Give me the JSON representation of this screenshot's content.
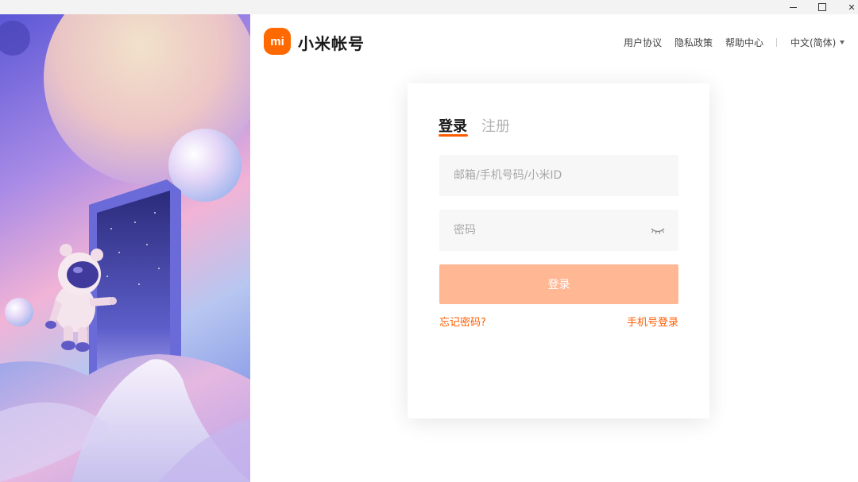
{
  "window": {
    "minimize_icon": "minimize-icon",
    "maximize_icon": "maximize-icon",
    "close_icon": "close-icon",
    "close_glyph": "✕"
  },
  "header": {
    "logo_text": "mi",
    "brand_name": "小米帐号",
    "nav": [
      "用户协议",
      "隐私政策",
      "帮助中心"
    ],
    "language": "中文(简体)"
  },
  "login": {
    "tabs": [
      {
        "label": "登录",
        "active": true
      },
      {
        "label": "注册",
        "active": false
      }
    ],
    "account_placeholder": "邮箱/手机号码/小米ID",
    "account_value": "",
    "password_placeholder": "密码",
    "password_value": "",
    "submit_label": "登录",
    "forgot_label": "忘记密码?",
    "phone_login_label": "手机号登录"
  },
  "colors": {
    "accent": "#ff5c00",
    "logo": "#ff6900",
    "button_disabled": "#ffb794"
  }
}
